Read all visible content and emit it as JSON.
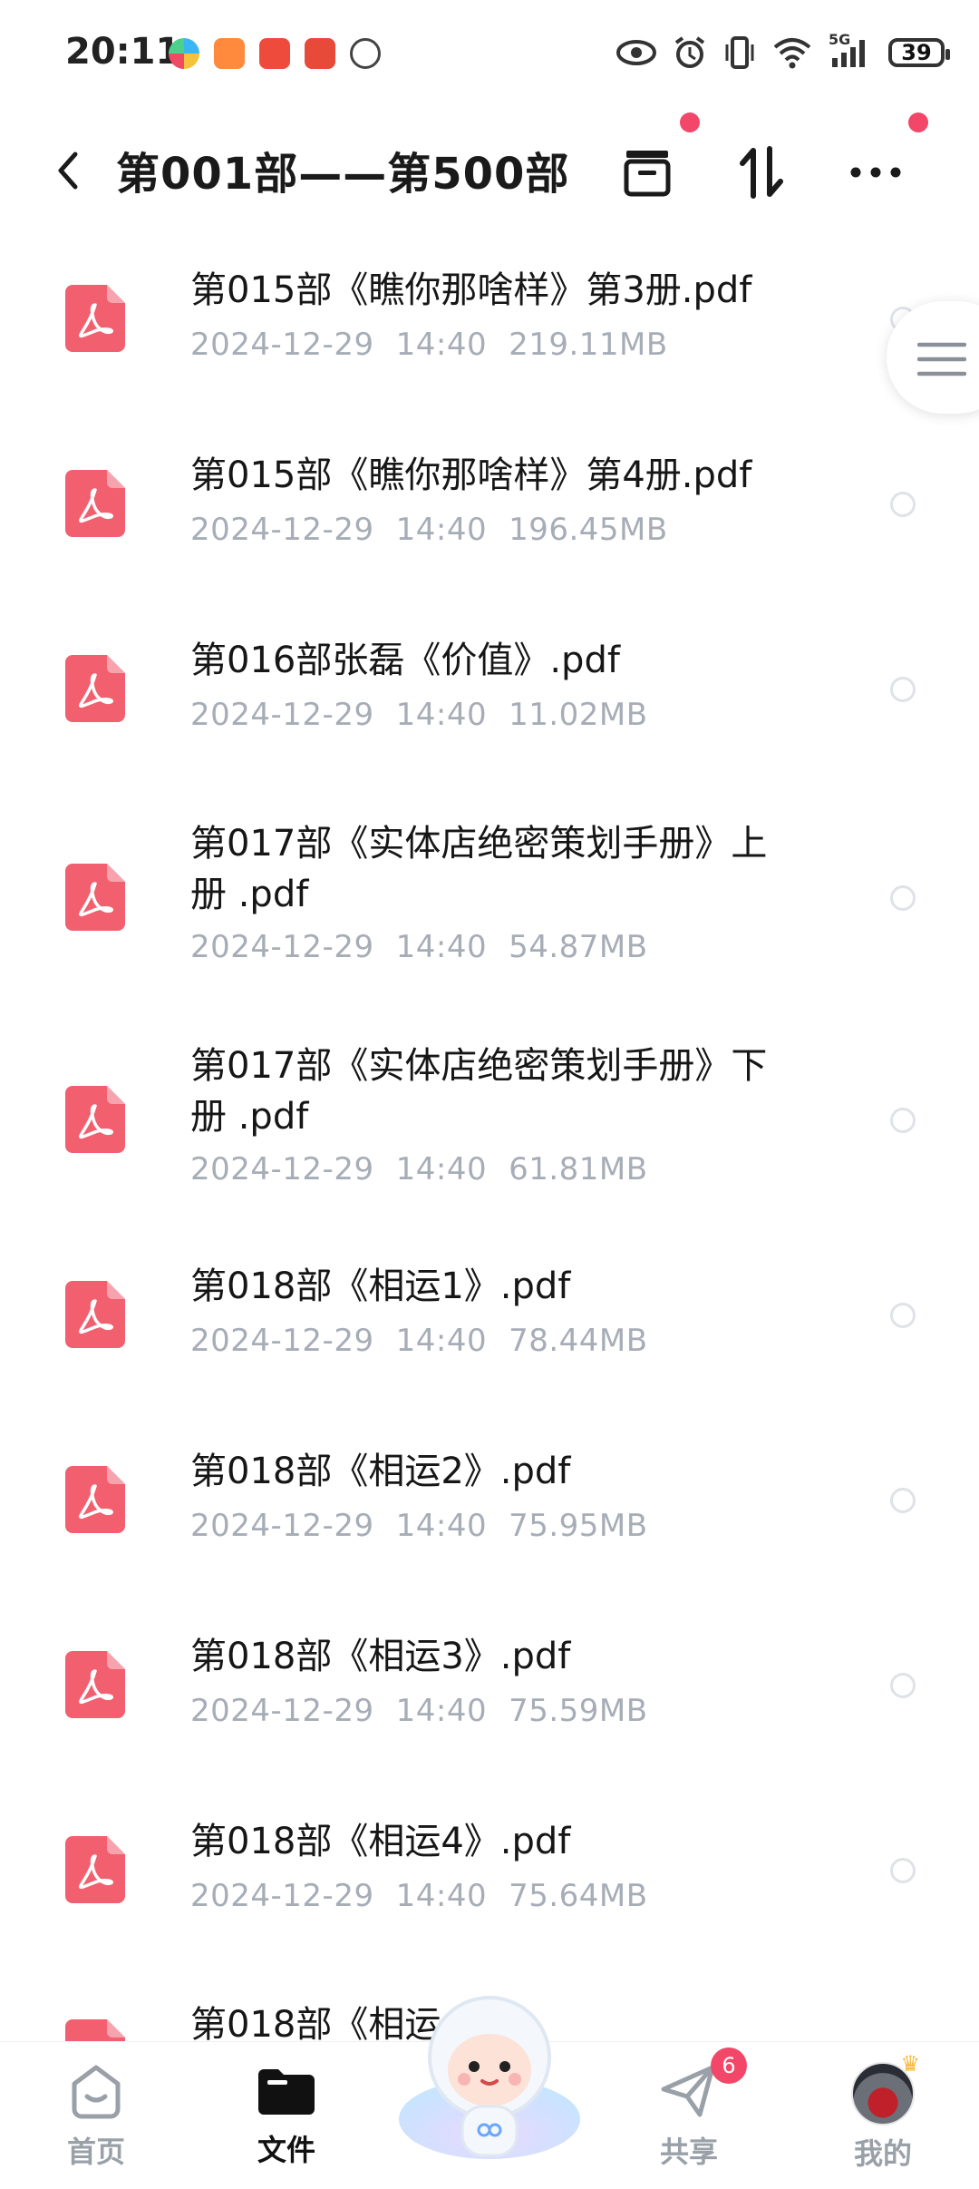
{
  "status_bar": {
    "time": "20:11",
    "battery": "39",
    "network": "5G",
    "icons": [
      "eye-icon",
      "alarm-icon",
      "vibrate-icon",
      "wifi-icon",
      "signal-icon",
      "battery-icon"
    ]
  },
  "header": {
    "title": "第001部——第500部",
    "back_icon": "chevron-left-icon",
    "actions": [
      "archive-icon",
      "sort-icon",
      "more-icon"
    ]
  },
  "files": [
    {
      "name": "第015部《瞧你那啥样》第3册.pdf",
      "date": "2024-12-29",
      "time": "14:40",
      "size": "219.11MB"
    },
    {
      "name": "第015部《瞧你那啥样》第4册.pdf",
      "date": "2024-12-29",
      "time": "14:40",
      "size": "196.45MB"
    },
    {
      "name": "第016部张磊《价值》.pdf",
      "date": "2024-12-29",
      "time": "14:40",
      "size": "11.02MB"
    },
    {
      "name": "第017部《实体店绝密策划手册》上册 .pdf",
      "date": "2024-12-29",
      "time": "14:40",
      "size": "54.87MB"
    },
    {
      "name": "第017部《实体店绝密策划手册》下册 .pdf",
      "date": "2024-12-29",
      "time": "14:40",
      "size": "61.81MB"
    },
    {
      "name": "第018部《相运1》.pdf",
      "date": "2024-12-29",
      "time": "14:40",
      "size": "78.44MB"
    },
    {
      "name": "第018部《相运2》.pdf",
      "date": "2024-12-29",
      "time": "14:40",
      "size": "75.95MB"
    },
    {
      "name": "第018部《相运3》.pdf",
      "date": "2024-12-29",
      "time": "14:40",
      "size": "75.59MB"
    },
    {
      "name": "第018部《相运4》.pdf",
      "date": "2024-12-29",
      "time": "14:40",
      "size": "75.64MB"
    },
    {
      "name": "第018部《相运",
      "date": "",
      "time": "",
      "size": ""
    }
  ],
  "bottom_nav": {
    "home": "首页",
    "files": "文件",
    "share": "共享",
    "share_badge": "6",
    "mine": "我的"
  },
  "colors": {
    "accent_red": "#f24768",
    "pdf_red": "#f2606f",
    "meta_gray": "#a7adb7"
  }
}
